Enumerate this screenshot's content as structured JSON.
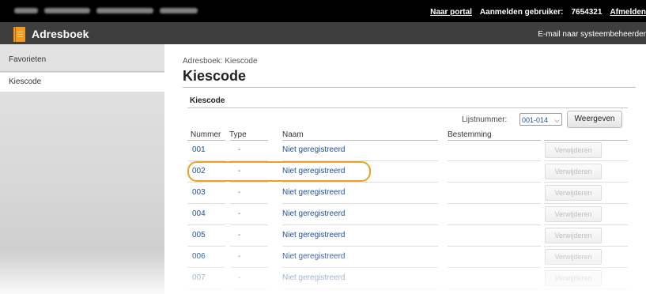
{
  "topbar": {
    "portal_link": "Naar portal",
    "login_user_label": "Aanmelden gebruiker:",
    "user_id": "7654321",
    "logout_link": "Afmelden"
  },
  "titlebar": {
    "app_title": "Adresboek",
    "icon": "address-book-icon",
    "sysadmin_link": "E-mail naar systeembeheerder"
  },
  "sidebar": {
    "items": [
      {
        "label": "Favorieten",
        "selected": false
      },
      {
        "label": "Kiescode",
        "selected": true
      }
    ]
  },
  "main": {
    "breadcrumb": "Adresboek: Kiescode",
    "page_title": "Kiescode",
    "section_title": "Kiescode",
    "list_label": "Lijstnummer:",
    "list_select_value": "001-014",
    "show_button": "Weergeven",
    "columns": [
      "Nummer",
      "Type",
      "Naam",
      "Bestemming"
    ],
    "rows": [
      {
        "number": "001",
        "type": "-",
        "name": "Niet geregistreerd",
        "destination": "",
        "action": "Verwijderen"
      },
      {
        "number": "002",
        "type": "-",
        "name": "Niet geregistreerd",
        "destination": "",
        "action": "Verwijderen"
      },
      {
        "number": "003",
        "type": "-",
        "name": "Niet geregistreerd",
        "destination": "",
        "action": "Verwijderen"
      },
      {
        "number": "004",
        "type": "-",
        "name": "Niet geregistreerd",
        "destination": "",
        "action": "Verwijderen"
      },
      {
        "number": "005",
        "type": "-",
        "name": "Niet geregistreerd",
        "destination": "",
        "action": "Verwijderen"
      },
      {
        "number": "006",
        "type": "-",
        "name": "Niet geregistreerd",
        "destination": "",
        "action": "Verwijderen"
      },
      {
        "number": "007",
        "type": "-",
        "name": "Niet geregistreerd",
        "destination": "",
        "action": "Verwijderen"
      }
    ],
    "highlighted_row": "002"
  },
  "colors": {
    "topbar": "#000000",
    "titlebar": "#3e3e3e",
    "accent": "#f39a1c",
    "link": "#1f4f9f",
    "highlight": "#f0a020"
  }
}
